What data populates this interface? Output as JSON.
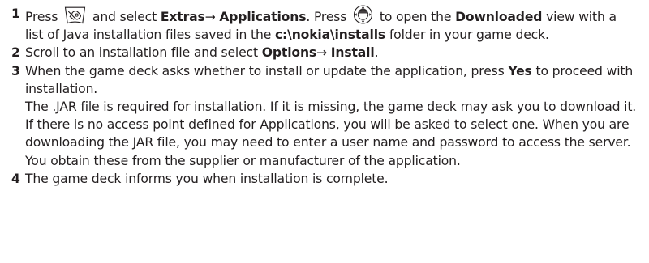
{
  "steps": [
    {
      "number": "1",
      "t1": "Press",
      "t2": "and select",
      "b1": "Extras",
      "arrow": "→",
      "b2": "Applications",
      "t3": ". Press",
      "t4": "to open the",
      "b3": "Downloaded",
      "t5": "view with a list of Java installation files saved in the",
      "b4": "c:\\nokia\\installs",
      "t6": "folder in your game deck.",
      "icons": [
        "menu-key-icon",
        "joystick-icon"
      ]
    },
    {
      "number": "2",
      "t1": "Scroll to an installation file and select",
      "b1": "Options",
      "arrow": "→",
      "b2": "Install",
      "t2": "."
    },
    {
      "number": "3",
      "t1": "When the game deck asks whether to install or update the application, press",
      "b1": "Yes",
      "t2": "to proceed with installation.",
      "note": "The .JAR file is required for installation. If it is missing, the game deck may ask you to download it. If there is no access point defined for Applications, you will be asked to select one. When you are downloading the JAR file, you may need to enter a user name and password to access the server. You obtain these from the supplier or manufacturer of the application."
    },
    {
      "number": "4",
      "t1": "The game deck informs you when installation is complete."
    }
  ],
  "colors": {
    "text": "#231f20"
  }
}
